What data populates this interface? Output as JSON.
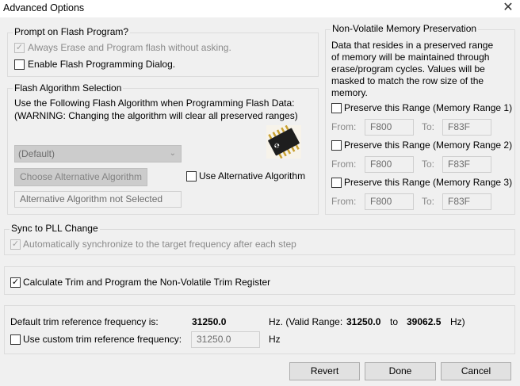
{
  "window": {
    "title": "Advanced Options",
    "close_glyph": "✕"
  },
  "prompt_group": {
    "legend": "Prompt on Flash Program?",
    "always_erase": {
      "label": "Always Erase and Program flash without asking.",
      "checked": true,
      "enabled": false
    },
    "enable_dialog": {
      "label": "Enable Flash Programming Dialog.",
      "checked": false
    }
  },
  "algo_group": {
    "legend": "Flash Algorithm Selection",
    "desc_line1": "Use the Following Flash Algorithm when Programming Flash Data:",
    "desc_line2": "(WARNING: Changing the algorithm will clear all preserved ranges)",
    "chip_icon": "chip-icon",
    "select_value": "(Default)",
    "choose_button": "Choose Alternative Algorithm",
    "use_alternative": {
      "label": "Use Alternative Algorithm",
      "checked": false
    },
    "status_field": "Alternative Algorithm not Selected"
  },
  "nvm_group": {
    "legend": "Non-Volatile Memory Preservation",
    "desc": [
      "Data that resides in a preserved range",
      "of memory will be maintained through",
      "erase/program cycles. Values will be",
      "masked to match the row size of the",
      "memory."
    ],
    "from_label": "From:",
    "to_label": "To:",
    "ranges": [
      {
        "label": "Preserve this Range (Memory Range 1)",
        "checked": false,
        "from": "F800",
        "to": "F83F"
      },
      {
        "label": "Preserve this Range (Memory Range 2)",
        "checked": false,
        "from": "F800",
        "to": "F83F"
      },
      {
        "label": "Preserve this Range (Memory Range 3)",
        "checked": false,
        "from": "F800",
        "to": "F83F"
      }
    ]
  },
  "pll_group": {
    "legend": "Sync to PLL Change",
    "auto_sync": {
      "label": "Automatically synchronize to the target frequency after each step",
      "checked": true,
      "enabled": false
    }
  },
  "trim": {
    "calc": {
      "label": "Calculate Trim and Program the Non-Volatile Trim Register",
      "checked": true
    }
  },
  "freq": {
    "default_label": "Default trim reference frequency is:",
    "default_value": "31250.0",
    "hz_valid_prefix": "Hz. (Valid Range:",
    "range_min": "31250.0",
    "range_to": "to",
    "range_max": "39062.5",
    "range_suffix": "Hz)",
    "custom": {
      "label": "Use custom trim reference frequency:",
      "checked": false
    },
    "custom_value": "31250.0",
    "custom_unit": "Hz"
  },
  "buttons": {
    "revert": "Revert",
    "done": "Done",
    "cancel": "Cancel"
  }
}
